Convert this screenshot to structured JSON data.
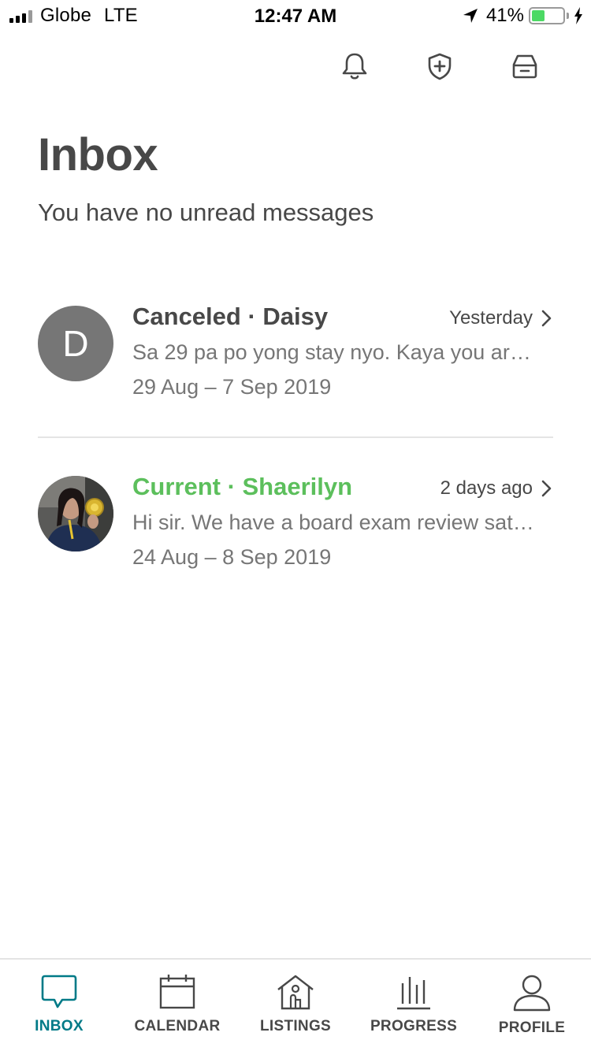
{
  "status_bar": {
    "carrier": "Globe",
    "network": "LTE",
    "time": "12:47 AM",
    "battery_percent": "41%",
    "battery_level": 0.41,
    "battery_color": "#4cd964"
  },
  "top_icons": [
    "bell-icon",
    "shield-plus-icon",
    "archive-box-icon"
  ],
  "header": {
    "title": "Inbox",
    "subtitle": "You have no unread messages"
  },
  "threads": [
    {
      "status": "Canceled",
      "name": "Daisy",
      "title": "Canceled · Daisy",
      "time": "Yesterday",
      "preview": "Sa 29 pa po yong stay nyo. Kaya you are...",
      "dates": "29 Aug – 7 Sep 2019",
      "avatar_letter": "D",
      "title_color": "#484848"
    },
    {
      "status": "Current",
      "name": "Shaerilyn",
      "title": "Current · Shaerilyn",
      "time": "2 days ago",
      "preview": "Hi sir. We have a board exam review saturday...",
      "dates": "24 Aug – 8 Sep 2019",
      "avatar_letter": "",
      "title_color": "#5cbf5c"
    }
  ],
  "tabs": [
    {
      "label": "INBOX",
      "icon": "chat-bubble-icon",
      "active": true
    },
    {
      "label": "CALENDAR",
      "icon": "calendar-icon",
      "active": false
    },
    {
      "label": "LISTINGS",
      "icon": "house-icon",
      "active": false
    },
    {
      "label": "PROGRESS",
      "icon": "bar-chart-icon",
      "active": false
    },
    {
      "label": "PROFILE",
      "icon": "person-icon",
      "active": false
    }
  ],
  "colors": {
    "accent": "#007a87",
    "text": "#484848",
    "muted": "#767676",
    "current_status": "#5cbf5c"
  }
}
